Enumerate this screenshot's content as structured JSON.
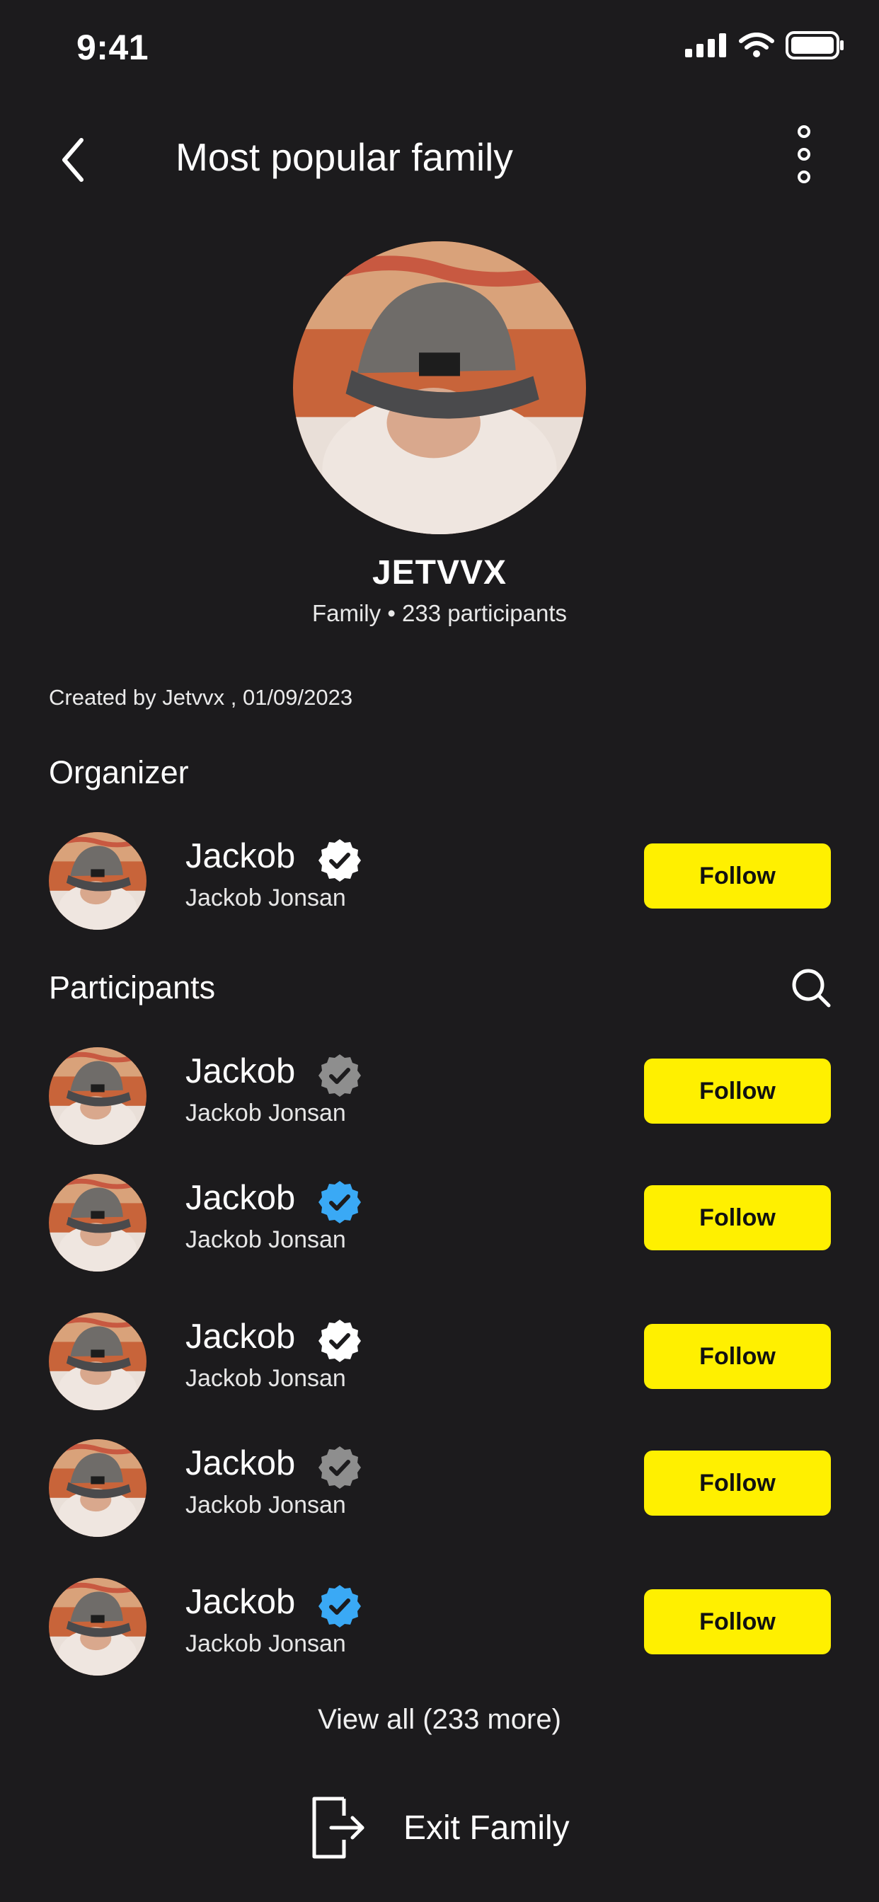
{
  "status_bar": {
    "time": "9:41"
  },
  "header": {
    "title": "Most popular family"
  },
  "profile": {
    "name": "JETVVX",
    "type": "Family",
    "separator": "•",
    "participants": "233 participants",
    "created": "Created by Jetvvx , 01/09/2023"
  },
  "organizer": {
    "section_title": "Organizer",
    "name": "Jackob",
    "handle": "Jackob Jonsan",
    "follow_label": "Follow",
    "badge_color": "#ffffff"
  },
  "participants": {
    "section_title": "Participants",
    "items": [
      {
        "name": "Jackob",
        "handle": "Jackob Jonsan",
        "follow_label": "Follow",
        "badge_color": "#8e8e8e"
      },
      {
        "name": "Jackob",
        "handle": "Jackob Jonsan",
        "follow_label": "Follow",
        "badge_color": "#3aa9f5"
      },
      {
        "name": "Jackob",
        "handle": "Jackob Jonsan",
        "follow_label": "Follow",
        "badge_color": "#ffffff"
      },
      {
        "name": "Jackob",
        "handle": "Jackob Jonsan",
        "follow_label": "Follow",
        "badge_color": "#8e8e8e"
      },
      {
        "name": "Jackob",
        "handle": "Jackob Jonsan",
        "follow_label": "Follow",
        "badge_color": "#3aa9f5"
      }
    ]
  },
  "view_all": "View all (233 more)",
  "exit": {
    "label": "Exit Family"
  },
  "colors": {
    "background": "#1c1b1d",
    "accent": "#fff000"
  }
}
